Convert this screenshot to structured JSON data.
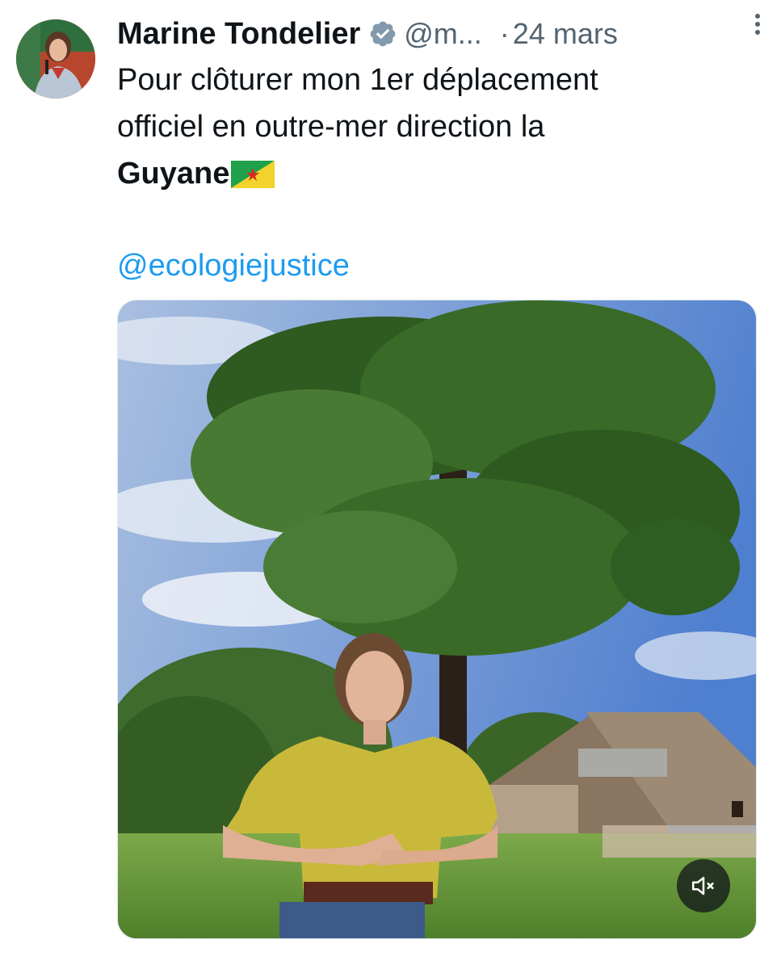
{
  "tweet": {
    "author": {
      "name": "Marine Tondelier",
      "handle": "@m...",
      "verified": true
    },
    "date_separator": "·",
    "date": "24 mars",
    "text_line_1": "Pour clôturer mon 1er déplacement",
    "text_line_2": "officiel en outre-mer direction la",
    "text_bold": "Guyane",
    "flag_icon": "french-guiana-flag-icon",
    "mention": "@ecologiejustice",
    "media": {
      "type": "video",
      "muted": true,
      "mute_icon": "volume-muted-icon"
    }
  },
  "colors": {
    "text": "#0f1419",
    "secondary": "#536471",
    "link": "#1d9bf0",
    "verified": "#829aab"
  }
}
